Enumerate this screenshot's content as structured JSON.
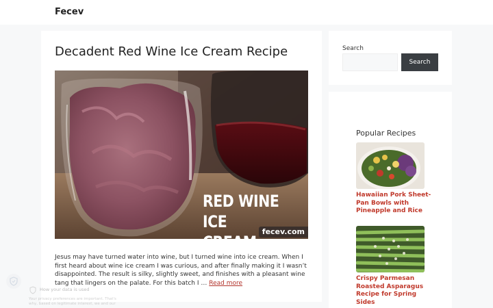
{
  "header": {
    "site_title": "Fecev"
  },
  "post": {
    "title": "Decadent Red Wine Ice Cream Recipe",
    "hero_caption_line1": "RED WINE",
    "hero_caption_line2": "ICE CREAM",
    "hero_tag": "fecev.com",
    "excerpt": "Jesus may have turned water into wine, but I turned wine into ice cream. When I first heard about wine ice cream I was curious, and after finally making it I wasn’t disappointed. The result is silky, slightly sweet, and finishes with a pleasant wine tang that lingers on the palate. For this batch I … ",
    "read_more": "Read more"
  },
  "search": {
    "label": "Search",
    "input_value": "",
    "button_label": "Search"
  },
  "popular": {
    "title": "Popular Recipes",
    "items": [
      {
        "label": "Hawaiian Pork Sheet-Pan Bowls with Pineapple and Rice",
        "thumb_icon": "salad-bowl-photo"
      },
      {
        "label": "Crispy Parmesan Roasted Asparagus Recipe for Spring Sides",
        "thumb_icon": "asparagus-photo"
      }
    ]
  },
  "consent": {
    "title": "How your data is used",
    "body": "Your privacy preferences are important. That's why, based on legitimate interest, we and our"
  },
  "colors": {
    "accent_link": "#c0392b",
    "button_bg": "#3a3e42",
    "page_bg": "#f7f8f9"
  }
}
